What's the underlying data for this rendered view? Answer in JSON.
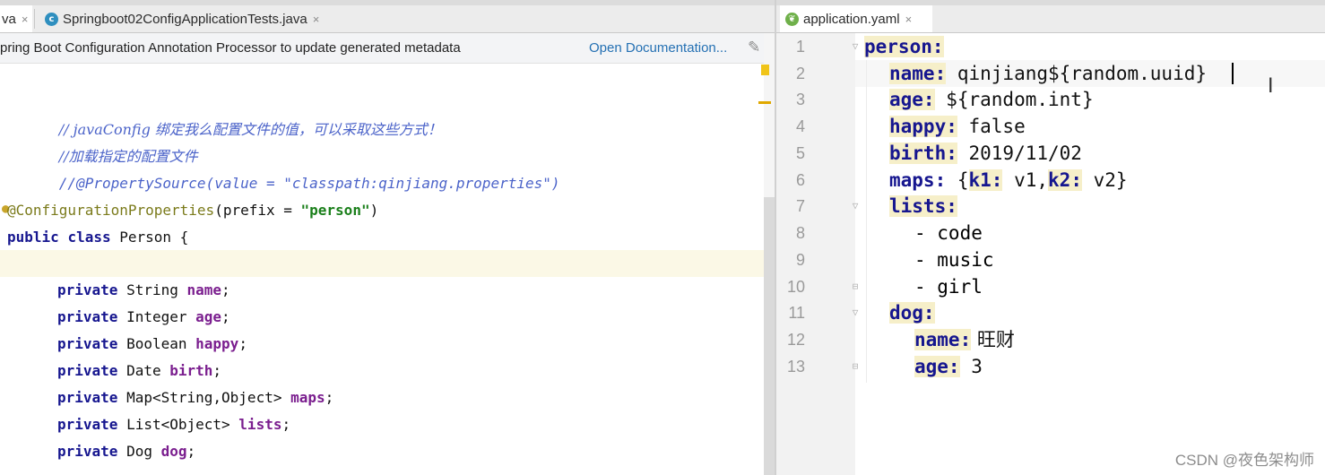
{
  "left_pane": {
    "tabs": [
      {
        "label": "va"
      },
      {
        "label": "Springboot02ConfigApplicationTests.java"
      }
    ],
    "tab_close": "×",
    "tab_icon_letter": "c",
    "banner": {
      "text": "pring Boot Configuration Annotation Processor to update generated metadata",
      "link": "Open Documentation..."
    },
    "code_lines": [
      "// javaConfig 绑定我么配置文件的值，可以采取这些方式！",
      "//加载指定的配置文件",
      "//@PropertySource(value = \"classpath:qinjiang.properties\")",
      "",
      "@ConfigurationProperties(prefix = \"person\")",
      "public class Person {",
      "",
      "    private String name;",
      "    private Integer age;",
      "    private Boolean happy;",
      "    private Date birth;",
      "    private Map<String,Object> maps;",
      "    private List<Object> lists;",
      "    private Dog dog;"
    ],
    "tokens": {
      "comment1": "// javaConfig 绑定我么配置文件的值，可以采取这些方式！",
      "comment2": "//加载指定的配置文件",
      "comment3": "//@PropertySource(value = \"classpath:qinjiang.properties\")",
      "annotation": "@ConfigurationProperties",
      "ann_open": "(prefix = ",
      "ann_str": "\"person\"",
      "ann_close": ")",
      "public": "public",
      "class": "class",
      "class_name": " Person {",
      "private": "private",
      "fields": [
        {
          "type": " String ",
          "name": "name"
        },
        {
          "type": " Integer ",
          "name": "age"
        },
        {
          "type": " Boolean ",
          "name": "happy"
        },
        {
          "type": " Date ",
          "name": "birth"
        },
        {
          "type": " Map<String,Object> ",
          "name": "maps"
        },
        {
          "type": " List<Object> ",
          "name": "lists"
        },
        {
          "type": " Dog ",
          "name": "dog"
        }
      ],
      "semicolon": ";"
    }
  },
  "right_pane": {
    "tab": {
      "label": "application.yaml"
    },
    "line_numbers": [
      "1",
      "2",
      "3",
      "4",
      "5",
      "6",
      "7",
      "8",
      "9",
      "10",
      "11",
      "12",
      "13"
    ],
    "yaml": {
      "person": "person:",
      "name_key": "name:",
      "name_val": " qinjiang${random.uuid}",
      "age_key": "age:",
      "age_val": " ${random.int}",
      "happy_key": "happy:",
      "happy_val": " false",
      "birth_key": "birth:",
      "birth_val": " 2019/11/02",
      "maps_key": "maps:",
      "maps_open": " {",
      "k1_key": "k1:",
      "k1_val": " v1,",
      "k2_key": "k2:",
      "k2_val": " v2}",
      "lists_key": "lists:",
      "list_items": [
        "- code",
        "- music",
        "- girl"
      ],
      "dog_key": "dog:",
      "dog_name_key": "name:",
      "dog_name_val": " 旺财",
      "dog_age_key": "age:",
      "dog_age_val": " 3"
    }
  },
  "watermark": "CSDN @夜色架构师"
}
